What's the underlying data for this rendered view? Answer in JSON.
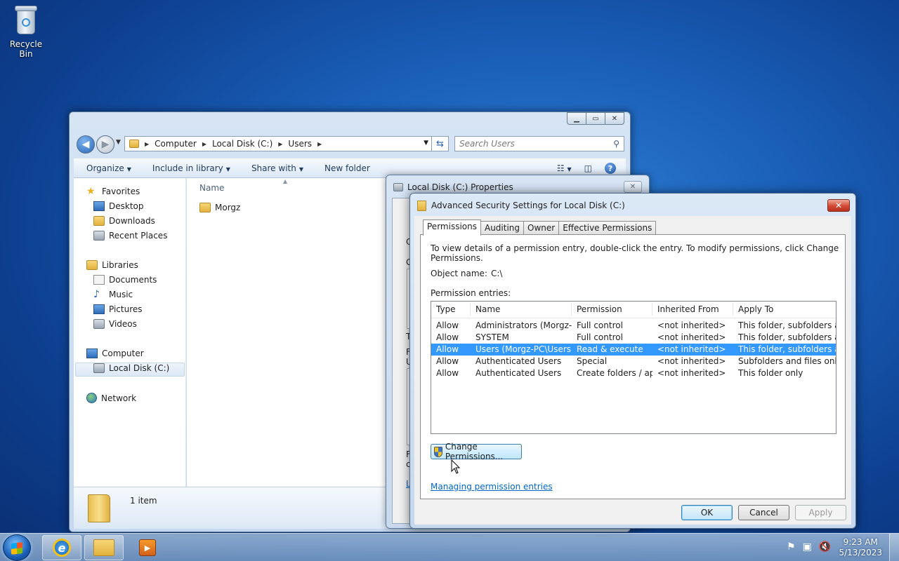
{
  "desktop": {
    "recycle_bin_label": "Recycle Bin"
  },
  "explorer": {
    "breadcrumb": [
      "Computer",
      "Local Disk (C:)",
      "Users"
    ],
    "search_placeholder": "Search Users",
    "toolbar": {
      "organize": "Organize",
      "include_in_library": "Include in library",
      "share_with": "Share with",
      "new_folder": "New folder"
    },
    "nav": {
      "favorites": "Favorites",
      "favorites_items": [
        "Desktop",
        "Downloads",
        "Recent Places"
      ],
      "libraries": "Libraries",
      "libraries_items": [
        "Documents",
        "Music",
        "Pictures",
        "Videos"
      ],
      "computer": "Computer",
      "computer_items": [
        "Local Disk (C:)"
      ],
      "network": "Network"
    },
    "column_name": "Name",
    "files": [
      "Morgz"
    ],
    "item_count": "1 item"
  },
  "properties": {
    "title": "Local Disk (C:) Properties",
    "fragments": [
      "C",
      "G",
      "T",
      "F",
      "U",
      "F",
      "c",
      "L"
    ]
  },
  "advanced": {
    "title": "Advanced Security Settings for Local Disk (C:)",
    "tabs": [
      "Permissions",
      "Auditing",
      "Owner",
      "Effective Permissions"
    ],
    "info_text": "To view details of a permission entry, double-click the entry. To modify permissions, click Change Permissions.",
    "object_name_label": "Object name:",
    "object_name_value": "C:\\",
    "permission_entries_label": "Permission entries:",
    "columns": [
      "Type",
      "Name",
      "Permission",
      "Inherited From",
      "Apply To"
    ],
    "rows": [
      [
        "Allow",
        "Administrators (Morgz-PC\\...",
        "Full control",
        "<not inherited>",
        "This folder, subfolders and..."
      ],
      [
        "Allow",
        "SYSTEM",
        "Full control",
        "<not inherited>",
        "This folder, subfolders and..."
      ],
      [
        "Allow",
        "Users (Morgz-PC\\Users)",
        "Read & execute",
        "<not inherited>",
        "This folder, subfolders and..."
      ],
      [
        "Allow",
        "Authenticated Users",
        "Special",
        "<not inherited>",
        "Subfolders and files only"
      ],
      [
        "Allow",
        "Authenticated Users",
        "Create folders / app...",
        "<not inherited>",
        "This folder only"
      ]
    ],
    "selected_row": 2,
    "change_permissions": "Change Permissions...",
    "managing_link": "Managing permission entries",
    "ok": "OK",
    "cancel": "Cancel",
    "apply": "Apply"
  },
  "taskbar": {
    "time": "9:23 AM",
    "date": "5/13/2023"
  },
  "colors": {
    "selection": "#3399ff",
    "link": "#0066cc"
  }
}
